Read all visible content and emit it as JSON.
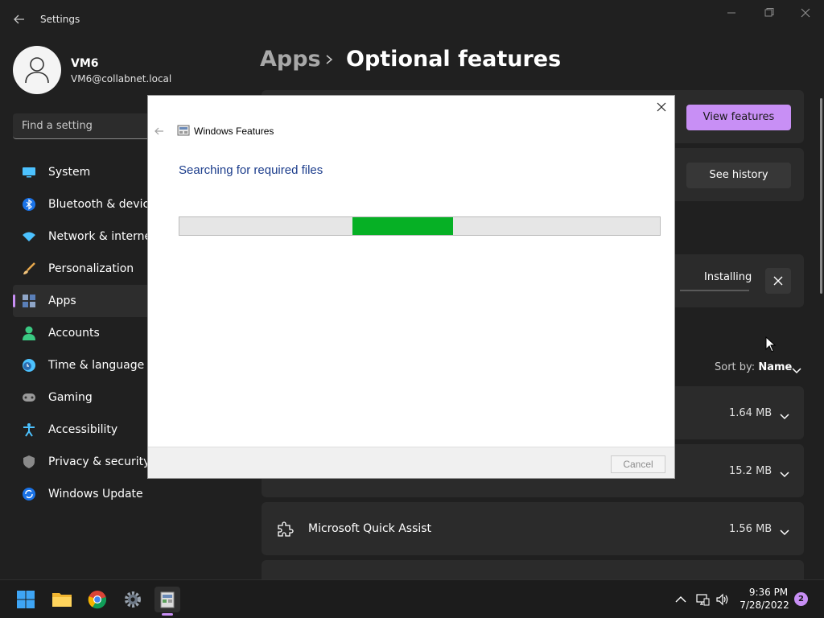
{
  "window": {
    "title": "Settings"
  },
  "profile": {
    "name": "VM6",
    "email": "VM6@collabnet.local"
  },
  "search": {
    "placeholder": "Find a setting"
  },
  "sidebar": {
    "items": [
      {
        "label": "System",
        "icon": "system-icon"
      },
      {
        "label": "Bluetooth & devices",
        "icon": "bluetooth-icon"
      },
      {
        "label": "Network & internet",
        "icon": "wifi-icon"
      },
      {
        "label": "Personalization",
        "icon": "brush-icon"
      },
      {
        "label": "Apps",
        "icon": "apps-icon",
        "active": true
      },
      {
        "label": "Accounts",
        "icon": "person-icon"
      },
      {
        "label": "Time & language",
        "icon": "clock-globe-icon"
      },
      {
        "label": "Gaming",
        "icon": "gamepad-icon"
      },
      {
        "label": "Accessibility",
        "icon": "accessibility-icon"
      },
      {
        "label": "Privacy & security",
        "icon": "shield-icon"
      },
      {
        "label": "Windows Update",
        "icon": "update-icon"
      }
    ]
  },
  "breadcrumb": {
    "parent": "Apps",
    "current": "Optional features"
  },
  "main": {
    "view_features_label": "View features",
    "see_history_label": "See history",
    "installing_label": "Installing",
    "sort_label": "Sort by:",
    "sort_value": "Name",
    "features": [
      {
        "name": "",
        "size": "1.64 MB"
      },
      {
        "name": "",
        "size": "15.2 MB"
      },
      {
        "name": "Microsoft Quick Assist",
        "size": "1.56 MB"
      }
    ]
  },
  "dialog": {
    "title": "Windows Features",
    "heading": "Searching for required files",
    "progress_fill_start": 0.36,
    "progress_fill_end": 0.57,
    "cancel_label": "Cancel"
  },
  "taskbar": {
    "time": "9:36 PM",
    "date": "7/28/2022",
    "notification_count": "2"
  },
  "colors": {
    "accent": "#c88ff5",
    "progress_green": "#06b025",
    "dialog_heading": "#1c3d8c"
  }
}
